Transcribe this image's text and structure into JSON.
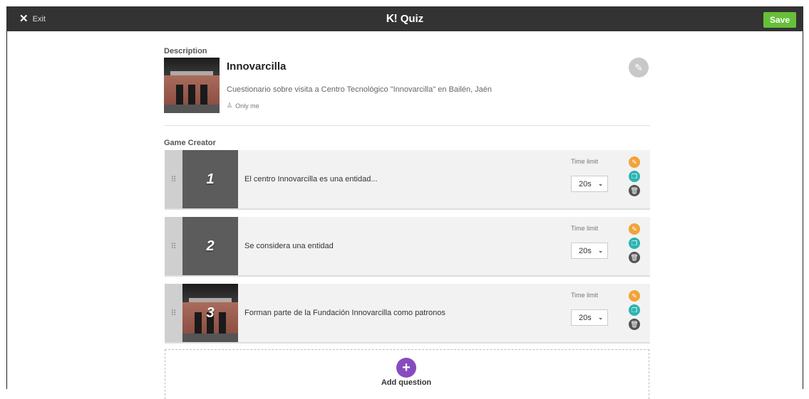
{
  "topbar": {
    "exit_label": "Exit",
    "brand_logo": "K!",
    "brand_text": "Quiz",
    "save_label": "Save"
  },
  "description": {
    "section_label": "Description",
    "title": "Innovarcilla",
    "text": "Cuestionario sobre visita a Centro Tecnológico \"Innovarcilla\" en Bailén, Jaén",
    "visibility": "Only me"
  },
  "game_creator": {
    "section_label": "Game Creator",
    "time_limit_label": "Time limit",
    "questions": [
      {
        "number": "1",
        "text": "El centro Innovarcilla es una entidad...",
        "time_limit": "20s"
      },
      {
        "number": "2",
        "text": "Se considera una entidad",
        "time_limit": "20s"
      },
      {
        "number": "3",
        "text": "Forman parte de la Fundación Innovarcilla como patronos",
        "time_limit": "20s"
      }
    ],
    "add_question_label": "Add question"
  },
  "colors": {
    "topbar": "#333333",
    "save": "#66bf39",
    "edit": "#f2a33a",
    "duplicate": "#2bb4b1",
    "delete": "#555555",
    "add": "#864cbf"
  }
}
